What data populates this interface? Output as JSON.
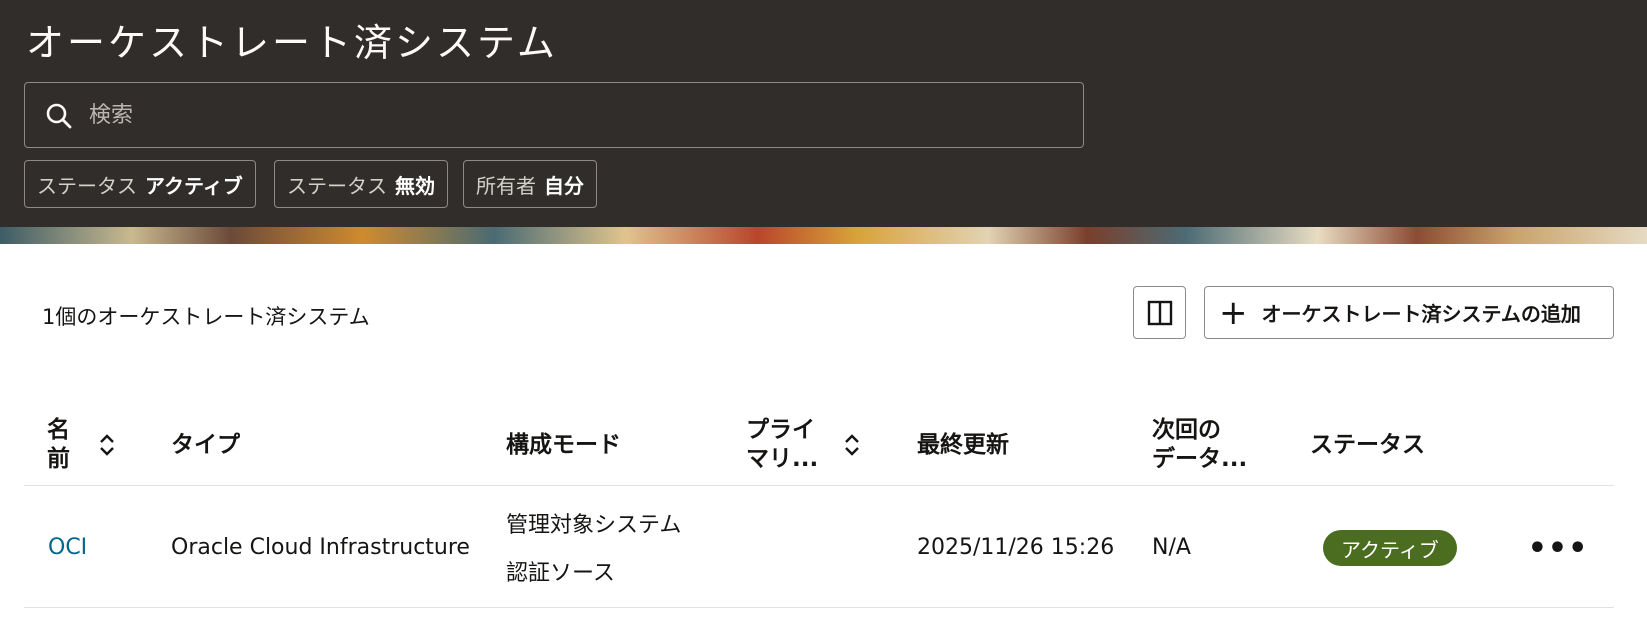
{
  "header": {
    "title": "オーケストレート済システム",
    "search": {
      "placeholder": "検索",
      "value": ""
    },
    "filters": [
      {
        "key": "ステータス",
        "value": "アクティブ"
      },
      {
        "key": "ステータス",
        "value": "無効"
      },
      {
        "key": "所有者",
        "value": "自分"
      }
    ]
  },
  "toolbar": {
    "count_label": "1個のオーケストレート済システム",
    "columns_icon": "columns-icon",
    "add_label": "オーケストレート済システムの追加",
    "add_symbol": "+"
  },
  "table": {
    "columns": [
      {
        "line1": "名",
        "line2": "前",
        "sortable": true
      },
      {
        "label": "タイプ"
      },
      {
        "label": "構成モード"
      },
      {
        "line1": "プライ",
        "line2": "マリ...",
        "sortable": true
      },
      {
        "label": "最終更新"
      },
      {
        "line1": "次回の",
        "line2": "データ..."
      },
      {
        "label": "ステータス"
      }
    ],
    "rows": [
      {
        "name": "OCI",
        "type": "Oracle Cloud Infrastructure",
        "modes": [
          "管理対象システム",
          "認証ソース"
        ],
        "primary": "",
        "last_updated": "2025/11/26 15:26",
        "next_data": "N/A",
        "status": "アクティブ",
        "actions": "•••"
      }
    ]
  },
  "colors": {
    "header_bg": "#312d2a",
    "link": "#00688c",
    "status_active": "#4b6d1f"
  }
}
